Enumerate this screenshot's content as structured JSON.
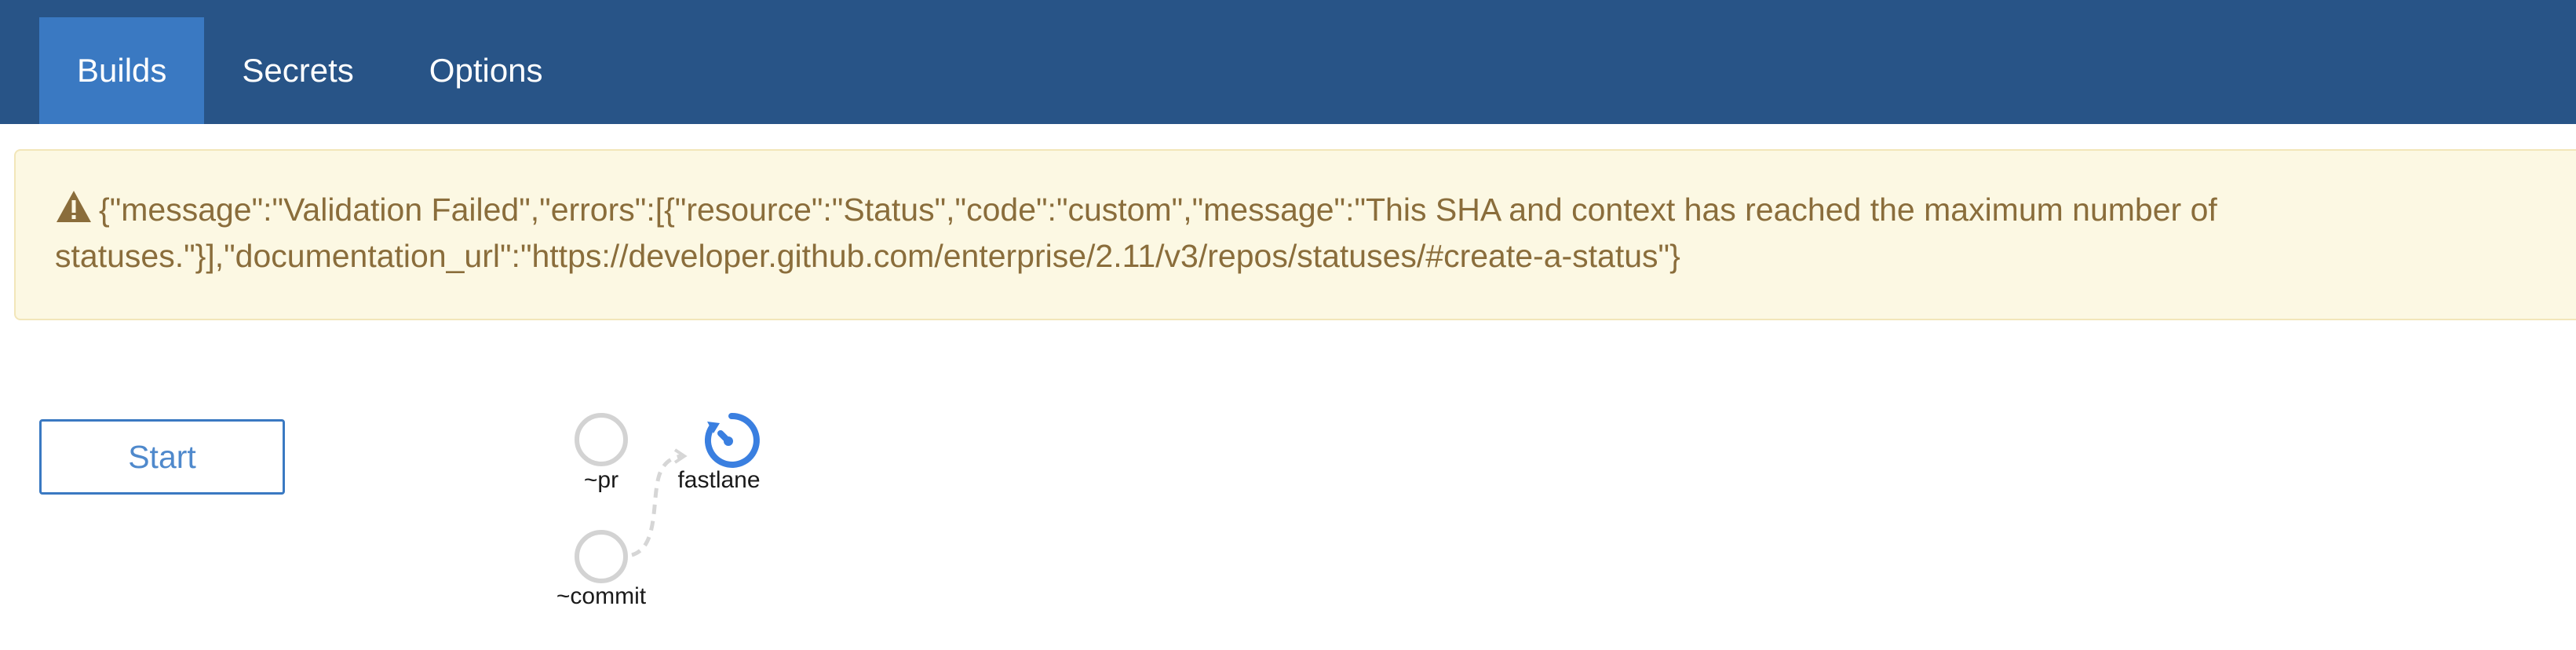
{
  "nav": {
    "tabs": [
      {
        "label": "Builds",
        "active": true
      },
      {
        "label": "Secrets",
        "active": false
      },
      {
        "label": "Options",
        "active": false
      }
    ]
  },
  "alert": {
    "icon": "warning-icon",
    "line1": "{\"message\":\"Validation Failed\",\"errors\":[{\"resource\":\"Status\",\"code\":\"custom\",\"message\":\"This SHA and context has reached the maximum number of",
    "line2": "statuses.\"}],\"documentation_url\":\"https://developer.github.com/enterprise/2.11/v3/repos/statuses/#create-a-status\"}"
  },
  "start_button": {
    "label": "Start"
  },
  "pipeline": {
    "nodes": {
      "pr": "~pr",
      "fastlane": "fastlane",
      "commit": "~commit"
    }
  },
  "colors": {
    "topbar": "#285487",
    "active_tab": "#3a79c2",
    "alert_bg": "#fcf8e3",
    "alert_text": "#8a6d3b",
    "node_idle": "#d3d3d3",
    "node_running": "#3a7fe0"
  }
}
